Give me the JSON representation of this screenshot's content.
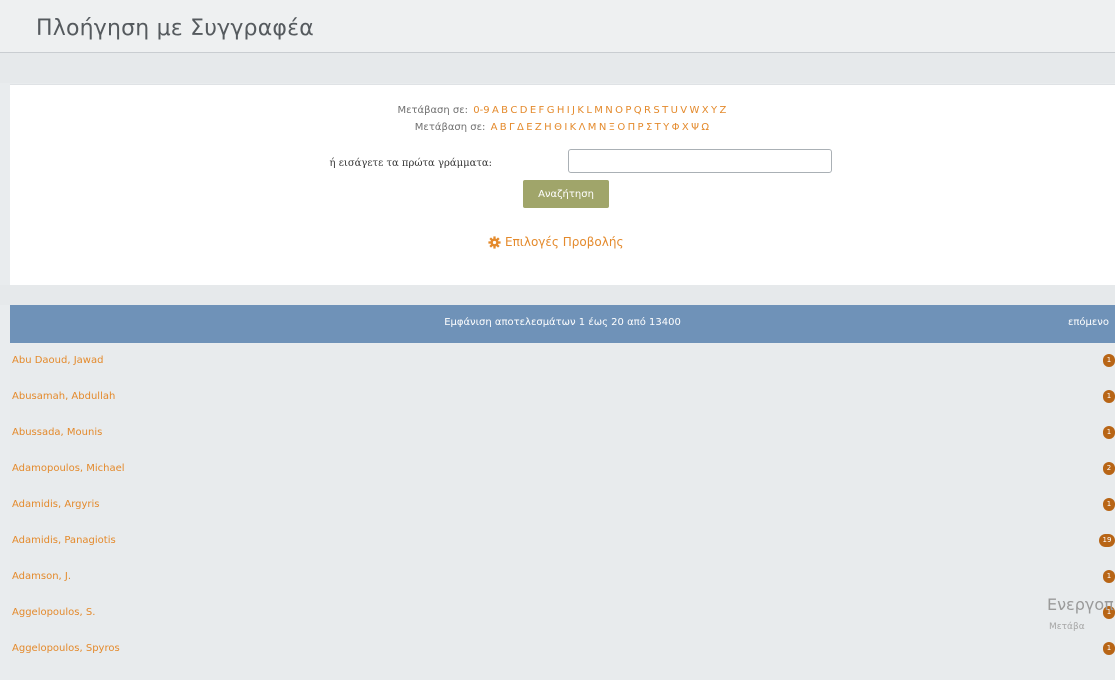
{
  "page": {
    "title": "Πλοήγηση με Συγγραφέα"
  },
  "jump": {
    "label": "Μετάβαση σε:",
    "latin": [
      "0-9",
      "A",
      "B",
      "C",
      "D",
      "E",
      "F",
      "G",
      "H",
      "I",
      "J",
      "K",
      "L",
      "M",
      "N",
      "O",
      "P",
      "Q",
      "R",
      "S",
      "T",
      "U",
      "V",
      "W",
      "X",
      "Y",
      "Z"
    ],
    "greek": [
      "Α",
      "Β",
      "Γ",
      "Δ",
      "Ε",
      "Ζ",
      "Η",
      "Θ",
      "Ι",
      "Κ",
      "Λ",
      "Μ",
      "Ν",
      "Ξ",
      "Ο",
      "Π",
      "Ρ",
      "Σ",
      "Τ",
      "Υ",
      "Φ",
      "Χ",
      "Ψ",
      "Ω"
    ]
  },
  "search": {
    "prefix_label": "ή εισάγετε τα πρώτα γράμματα:",
    "value": "",
    "button_label": "Αναζήτηση"
  },
  "view_options": {
    "label": "Επιλογές Προβολής",
    "icon": "gear-icon"
  },
  "results": {
    "summary": "Εμφάνιση αποτελεσμάτων 1 έως 20 από 13400",
    "next_label": "επόμενο"
  },
  "authors": [
    {
      "name": "Abu Daoud, Jawad",
      "count": "1"
    },
    {
      "name": "Abusamah, Abdullah",
      "count": "1"
    },
    {
      "name": "Abussada, Mounis",
      "count": "1"
    },
    {
      "name": "Adamopoulos, Michael",
      "count": "2"
    },
    {
      "name": "Adamidis, Argyris",
      "count": "1"
    },
    {
      "name": "Adamidis, Panagiotis",
      "count": "19"
    },
    {
      "name": "Adamson, J.",
      "count": "1"
    },
    {
      "name": "Aggelopoulos, S.",
      "count": "1"
    },
    {
      "name": "Aggelopoulos, Spyros",
      "count": "1"
    }
  ],
  "watermark": {
    "line1": "Ενεργοπ",
    "line2": "Μετάβα"
  },
  "colors": {
    "accent": "#e48a2c",
    "button": "#a0a56a",
    "results_bar": "#6f92b8",
    "badge": "#b86516"
  }
}
